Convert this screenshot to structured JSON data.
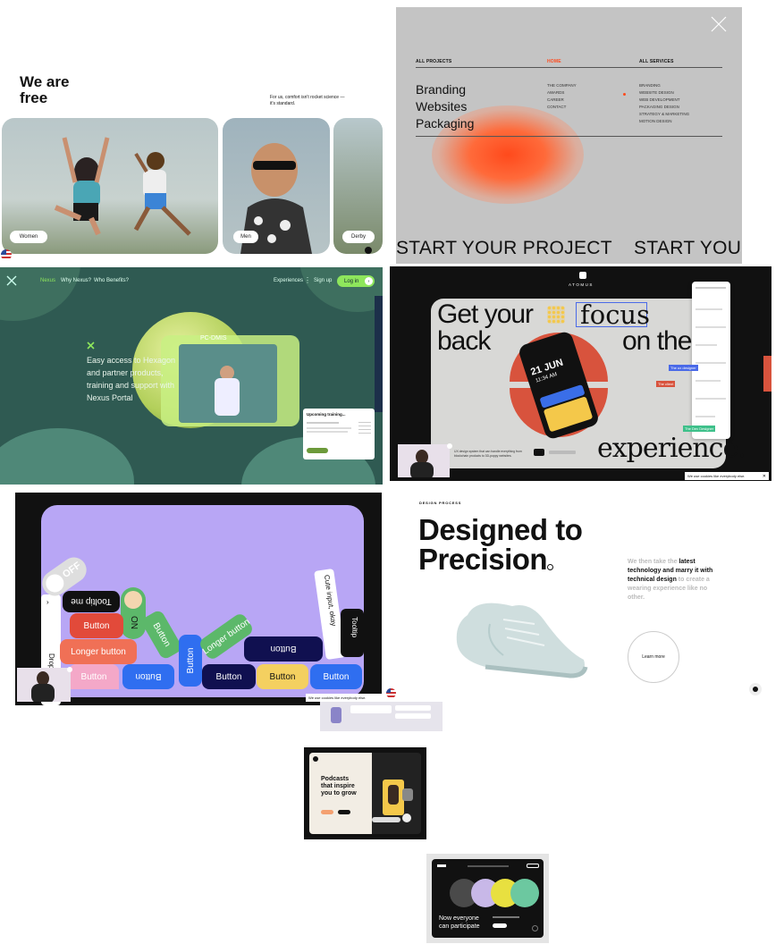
{
  "colors": {
    "accent_orange": "#ff4a1c",
    "nexus_green": "#8ee65c",
    "atomus_red": "#d8533d",
    "purple_card": "#b8a6f5",
    "dark_bg": "#111111"
  },
  "panel1": {
    "heading": "We are\nfree",
    "tagline": "For us, comfort isn't rocket science —\nit's standard.",
    "cards": [
      {
        "label": "Women"
      },
      {
        "label": "Men"
      },
      {
        "label": "Derby"
      }
    ]
  },
  "panel2": {
    "columns": [
      {
        "title": "ALL PROJECTS",
        "items": [
          "Branding",
          "Websites",
          "Packaging"
        ]
      },
      {
        "title": "HOME",
        "items": [
          "THE COMPANY",
          "AWARDS",
          "CAREER",
          "CONTACT"
        ]
      },
      {
        "title": "ALL SERVICES",
        "items": [
          "BRANDING",
          "WEBSITE DESIGN",
          "WEB DEVELOPMENT",
          "PACKAGING DESIGN",
          "STRATEGY & MARKETING",
          "MOTION DESIGN"
        ]
      }
    ],
    "marquee": "START YOUR PROJECT    START YOUR P"
  },
  "panel3": {
    "nav": [
      "Nexus",
      "Why Nexus?",
      "Who Benefits?"
    ],
    "nav_right": [
      "Experiences",
      "Sign up"
    ],
    "login": "Log in",
    "headline": "Easy access to Hexagon\nand partner products,\ntraining and support with\nNexus Portal",
    "card_title": "Upcoming training...",
    "screen_label": "PC-DMIS"
  },
  "panel4": {
    "brand": "ATOMUS",
    "headline_1": "Get your",
    "headline_focus": "focus",
    "headline_2": "back",
    "headline_3": "on the",
    "headline_4": "experience.",
    "phone_date": "21 JUN",
    "phone_time": "11:34 AM",
    "caption": "UX design system that can handle everything from\nblockchain products to 3D-poppy websites.",
    "cookie": "We use cookies like everybody else.",
    "tags": [
      "The ux designer",
      "The client",
      "The Dev Designer"
    ]
  },
  "panel5": {
    "buttons": [
      "Tooltip me",
      "Button",
      "Longer button",
      "Button",
      "Button",
      "Longer button",
      "Button",
      "Button",
      "Button",
      "Button",
      "Button"
    ],
    "toggle_off": "OFF",
    "toggle_on": "ON",
    "tooltip": "Tooltip",
    "dropdown": "Dropdown",
    "cute_input": "Cute input, okay",
    "cookie": "We use cookies like everybody else."
  },
  "panel6": {
    "overline": "DESIGN PROCESS",
    "headline": "Designed to\nPrecision",
    "copy_light_1": "We then take the ",
    "copy_bold_1": "latest\ntechnology and marry it with\ntechnical design",
    "copy_light_2": " to create a\nwearing experience like no\nother.",
    "learn_more": "Learn more"
  },
  "panel7": {
    "headline": "Podcasts\nthat inspire\nyou to grow"
  },
  "panel8": {
    "headline": "Now everyone\ncan participate"
  }
}
